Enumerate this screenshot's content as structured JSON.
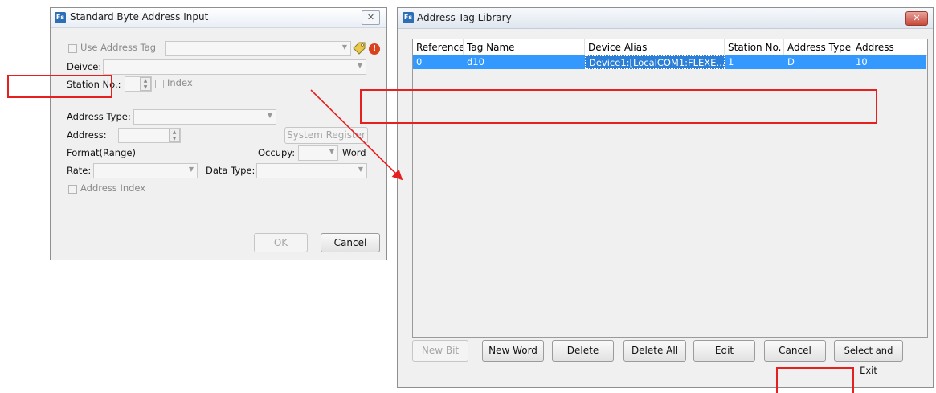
{
  "left_dialog": {
    "title": "Standard Byte Address Input",
    "close_glyph": "✕",
    "use_address_tag_label": "Use Address Tag",
    "device_label": "Deivce:",
    "station_label": "Station No.:",
    "index_label": "Index",
    "address_type_label": "Address Type:",
    "address_label": "Address:",
    "system_register_label": "System Register",
    "format_label": "Format(Range)",
    "occupy_label": "Occupy:",
    "word_label": "Word",
    "rate_label": "Rate:",
    "data_type_label": "Data Type:",
    "address_index_label": "Address Index",
    "ok_label": "OK",
    "cancel_label": "Cancel"
  },
  "right_dialog": {
    "title": "Address Tag Library",
    "close_glyph": "✕",
    "columns": [
      "Reference",
      "Tag Name",
      "Device Alias",
      "Station No.",
      "Address Type",
      "Address"
    ],
    "rows": [
      {
        "reference": "0",
        "tag_name": "d10",
        "device_alias": "Device1:[LocalCOM1:FLEXE...",
        "station": "1",
        "address_type": "D",
        "address": "10"
      }
    ],
    "buttons": {
      "new_bit": "New Bit",
      "new_word": "New Word",
      "delete": "Delete",
      "delete_all": "Delete All",
      "edit": "Edit",
      "cancel": "Cancel",
      "select_and_exit": "Select and Exit"
    }
  },
  "app_icon_text": "Fs",
  "annotation_color": "#e61f1f",
  "selection_color": "#3399ff"
}
